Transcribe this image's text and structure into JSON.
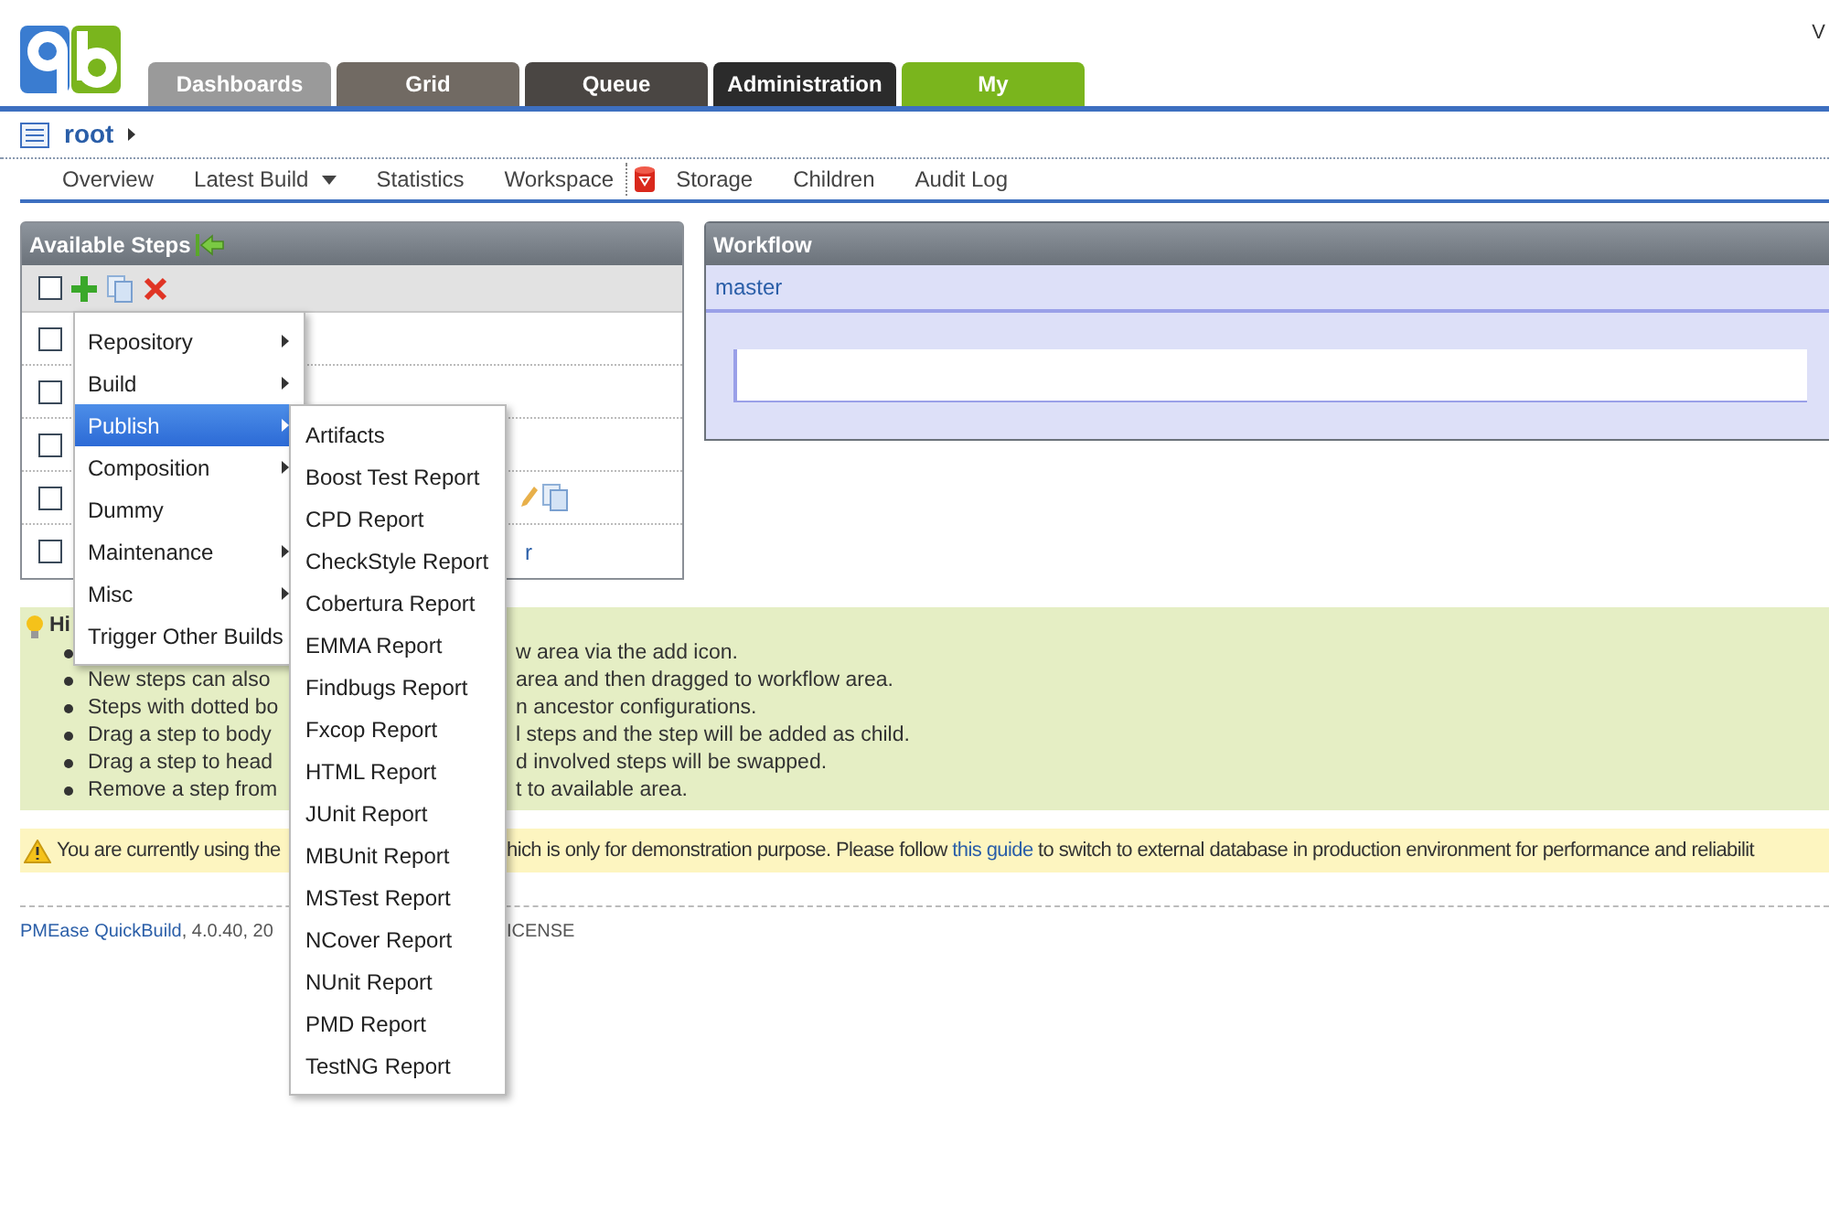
{
  "corner_text": "V",
  "tabs": [
    {
      "label": "Dashboards",
      "color": "#9a9a9a"
    },
    {
      "label": "Grid",
      "color": "#716a63"
    },
    {
      "label": "Queue",
      "color": "#4a4643"
    },
    {
      "label": "Administration",
      "color": "#2b2b2b"
    },
    {
      "label": "My",
      "color": "#7ab51d"
    }
  ],
  "breadcrumb": {
    "label": "root"
  },
  "nav": [
    {
      "label": "Overview",
      "kind": "link"
    },
    {
      "label": "Latest Build",
      "kind": "dropdown"
    },
    {
      "label": "Statistics",
      "kind": "link"
    },
    {
      "label": "Workspace",
      "kind": "link"
    },
    {
      "label": "Storage",
      "kind": "icon-link"
    },
    {
      "label": "Children",
      "kind": "link"
    },
    {
      "label": "Audit Log",
      "kind": "link"
    }
  ],
  "available_steps": {
    "title": "Available Steps",
    "select_all": {
      "checked": false
    },
    "rows": [
      {
        "kind": "plain",
        "checked": false
      },
      {
        "kind": "plain",
        "checked": false
      },
      {
        "kind": "plain",
        "checked": false
      },
      {
        "kind": "actions",
        "checked": false
      },
      {
        "kind": "text",
        "checked": false,
        "text": "r"
      }
    ]
  },
  "workflow": {
    "title": "Workflow",
    "tab": "master"
  },
  "hints": {
    "title": "Hi",
    "items": [
      {
        "right": "w area via the add icon."
      },
      {
        "left": "New steps can also",
        "right": "area and then dragged to workflow area."
      },
      {
        "left": "Steps with dotted bo",
        "right": "n ancestor configurations."
      },
      {
        "left": "Drag a step to body",
        "right": "l steps and the step will be added as child."
      },
      {
        "left": "Drag a step to head",
        "right": "d involved steps will be swapped."
      },
      {
        "left": "Remove a step from",
        "right": "t to available area."
      }
    ]
  },
  "warning": {
    "left": "You are currently using the",
    "right_before": "hich is only for demonstration purpose. Please follow",
    "link": "this guide",
    "right_after": "to switch to external database in production environment for performance and reliabilit"
  },
  "footer": {
    "link": "PMEase QuickBuild",
    "left": ", 4.0.40, 20",
    "right": "ICENSE"
  },
  "add_menu": {
    "items": [
      {
        "label": "Repository",
        "submenu": true,
        "selected": false
      },
      {
        "label": "Build",
        "submenu": true,
        "selected": false
      },
      {
        "label": "Publish",
        "submenu": true,
        "selected": true
      },
      {
        "label": "Composition",
        "submenu": true,
        "selected": false
      },
      {
        "label": "Dummy",
        "submenu": false,
        "selected": false
      },
      {
        "label": "Maintenance",
        "submenu": true,
        "selected": false
      },
      {
        "label": "Misc",
        "submenu": true,
        "selected": false
      },
      {
        "label": "Trigger Other Builds",
        "submenu": false,
        "selected": false
      }
    ],
    "submenu": [
      "Artifacts",
      "Boost Test Report",
      "CPD Report",
      "CheckStyle Report",
      "Cobertura Report",
      "EMMA Report",
      "Findbugs Report",
      "Fxcop Report",
      "HTML Report",
      "JUnit Report",
      "MBUnit Report",
      "MSTest Report",
      "NCover Report",
      "NUnit Report",
      "PMD Report",
      "TestNG Report"
    ]
  }
}
